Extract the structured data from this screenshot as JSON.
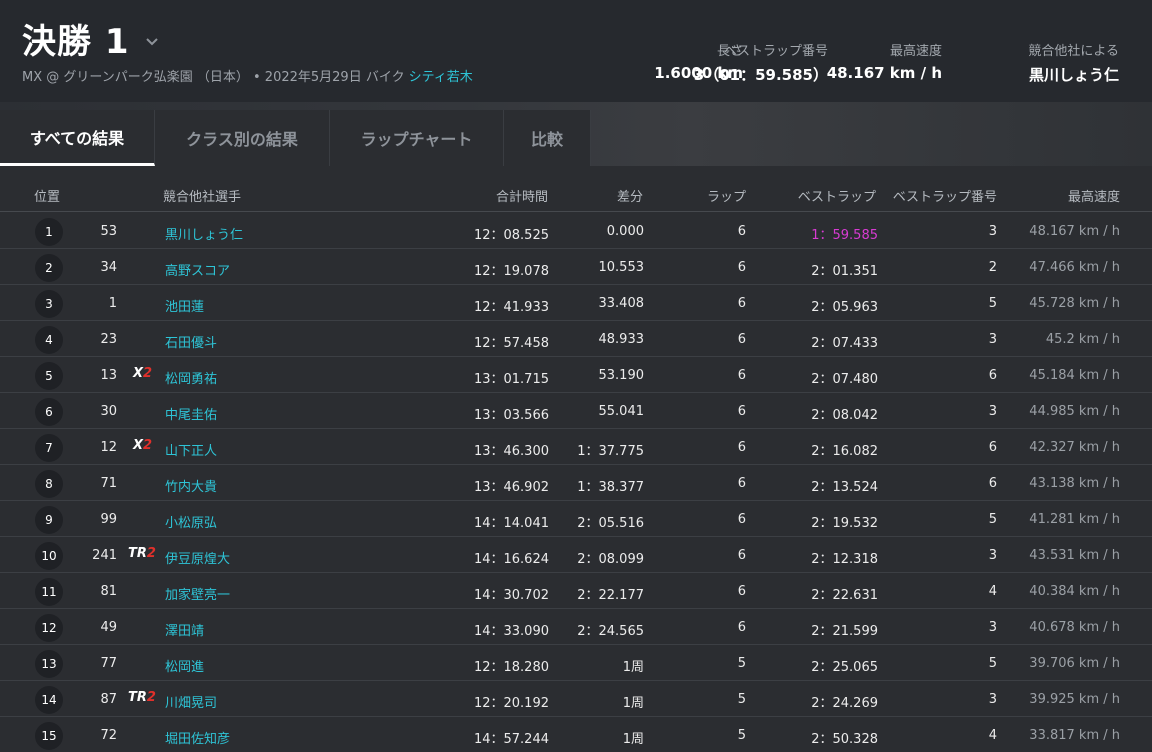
{
  "header": {
    "title": "決勝 1",
    "subtitle_main": "MX @ グリーンパーク弘楽園 （日本） • 2022年5月29日 バイク",
    "subtitle_link": "シティ若木",
    "stats": {
      "length_label": "長さ",
      "length_value": "1.6000 km",
      "bestlap_label": "ベストラップ番号",
      "bestlap_value": "3（01：59.585）",
      "topspeed_label": "最高速度",
      "topspeed_value": "48.167 km / h",
      "by_label": "競合他社による",
      "by_value": "黒川しょう仁"
    }
  },
  "tabs": [
    "すべての結果",
    "クラス別の結果",
    "ラップチャート",
    "比較"
  ],
  "columns": {
    "pos": "位置",
    "rider": "競合他社選手",
    "total": "合計時間",
    "gap": "差分",
    "laps": "ラップ",
    "best_lap": "ベストラップ",
    "best_lap_no": "ベストラップ番号",
    "top_speed": "最高速度"
  },
  "rows": [
    {
      "pos": "1",
      "num": "53",
      "badge": "",
      "name": "黒川しょう仁",
      "total": "12：08.525",
      "gap": "0.000",
      "laps": "6",
      "best": "1：59.585",
      "best_no": "3",
      "speed": "48.167 km / h",
      "is_best": true
    },
    {
      "pos": "2",
      "num": "34",
      "badge": "",
      "name": "高野スコア",
      "total": "12：19.078",
      "gap": "10.553",
      "laps": "6",
      "best": "2：01.351",
      "best_no": "2",
      "speed": "47.466 km / h"
    },
    {
      "pos": "3",
      "num": "1",
      "badge": "",
      "name": "池田蓮",
      "total": "12：41.933",
      "gap": "33.408",
      "laps": "6",
      "best": "2：05.963",
      "best_no": "5",
      "speed": "45.728 km / h"
    },
    {
      "pos": "4",
      "num": "23",
      "badge": "",
      "name": "石田優斗",
      "total": "12：57.458",
      "gap": "48.933",
      "laps": "6",
      "best": "2：07.433",
      "best_no": "3",
      "speed": "45.2 km / h"
    },
    {
      "pos": "5",
      "num": "13",
      "badge": "X2",
      "name": "松岡勇祐",
      "total": "13：01.715",
      "gap": "53.190",
      "laps": "6",
      "best": "2：07.480",
      "best_no": "6",
      "speed": "45.184 km / h"
    },
    {
      "pos": "6",
      "num": "30",
      "badge": "",
      "name": "中尾圭佑",
      "total": "13：03.566",
      "gap": "55.041",
      "laps": "6",
      "best": "2：08.042",
      "best_no": "3",
      "speed": "44.985 km / h"
    },
    {
      "pos": "7",
      "num": "12",
      "badge": "X2",
      "name": "山下正人",
      "total": "13：46.300",
      "gap": "1：37.775",
      "laps": "6",
      "best": "2：16.082",
      "best_no": "6",
      "speed": "42.327 km / h"
    },
    {
      "pos": "8",
      "num": "71",
      "badge": "",
      "name": "竹内大貴",
      "total": "13：46.902",
      "gap": "1：38.377",
      "laps": "6",
      "best": "2：13.524",
      "best_no": "6",
      "speed": "43.138 km / h"
    },
    {
      "pos": "9",
      "num": "99",
      "badge": "",
      "name": "小松原弘",
      "total": "14：14.041",
      "gap": "2：05.516",
      "laps": "6",
      "best": "2：19.532",
      "best_no": "5",
      "speed": "41.281 km / h"
    },
    {
      "pos": "10",
      "num": "241",
      "badge": "TR2",
      "name": "伊豆原煌大",
      "total": "14：16.624",
      "gap": "2：08.099",
      "laps": "6",
      "best": "2：12.318",
      "best_no": "3",
      "speed": "43.531 km / h"
    },
    {
      "pos": "11",
      "num": "81",
      "badge": "",
      "name": "加家壁亮一",
      "total": "14：30.702",
      "gap": "2：22.177",
      "laps": "6",
      "best": "2：22.631",
      "best_no": "4",
      "speed": "40.384 km / h"
    },
    {
      "pos": "12",
      "num": "49",
      "badge": "",
      "name": "澤田靖",
      "total": "14：33.090",
      "gap": "2：24.565",
      "laps": "6",
      "best": "2：21.599",
      "best_no": "3",
      "speed": "40.678 km / h"
    },
    {
      "pos": "13",
      "num": "77",
      "badge": "",
      "name": "松岡進",
      "total": "12：18.280",
      "gap": "1周",
      "laps": "5",
      "best": "2：25.065",
      "best_no": "5",
      "speed": "39.706 km / h"
    },
    {
      "pos": "14",
      "num": "87",
      "badge": "TR2",
      "name": "川畑晃司",
      "total": "12：20.192",
      "gap": "1周",
      "laps": "5",
      "best": "2：24.269",
      "best_no": "3",
      "speed": "39.925 km / h"
    },
    {
      "pos": "15",
      "num": "72",
      "badge": "",
      "name": "堀田佐知彦",
      "total": "14：57.244",
      "gap": "1周",
      "laps": "5",
      "best": "2：50.328",
      "best_no": "4",
      "speed": "33.817 km / h"
    }
  ]
}
